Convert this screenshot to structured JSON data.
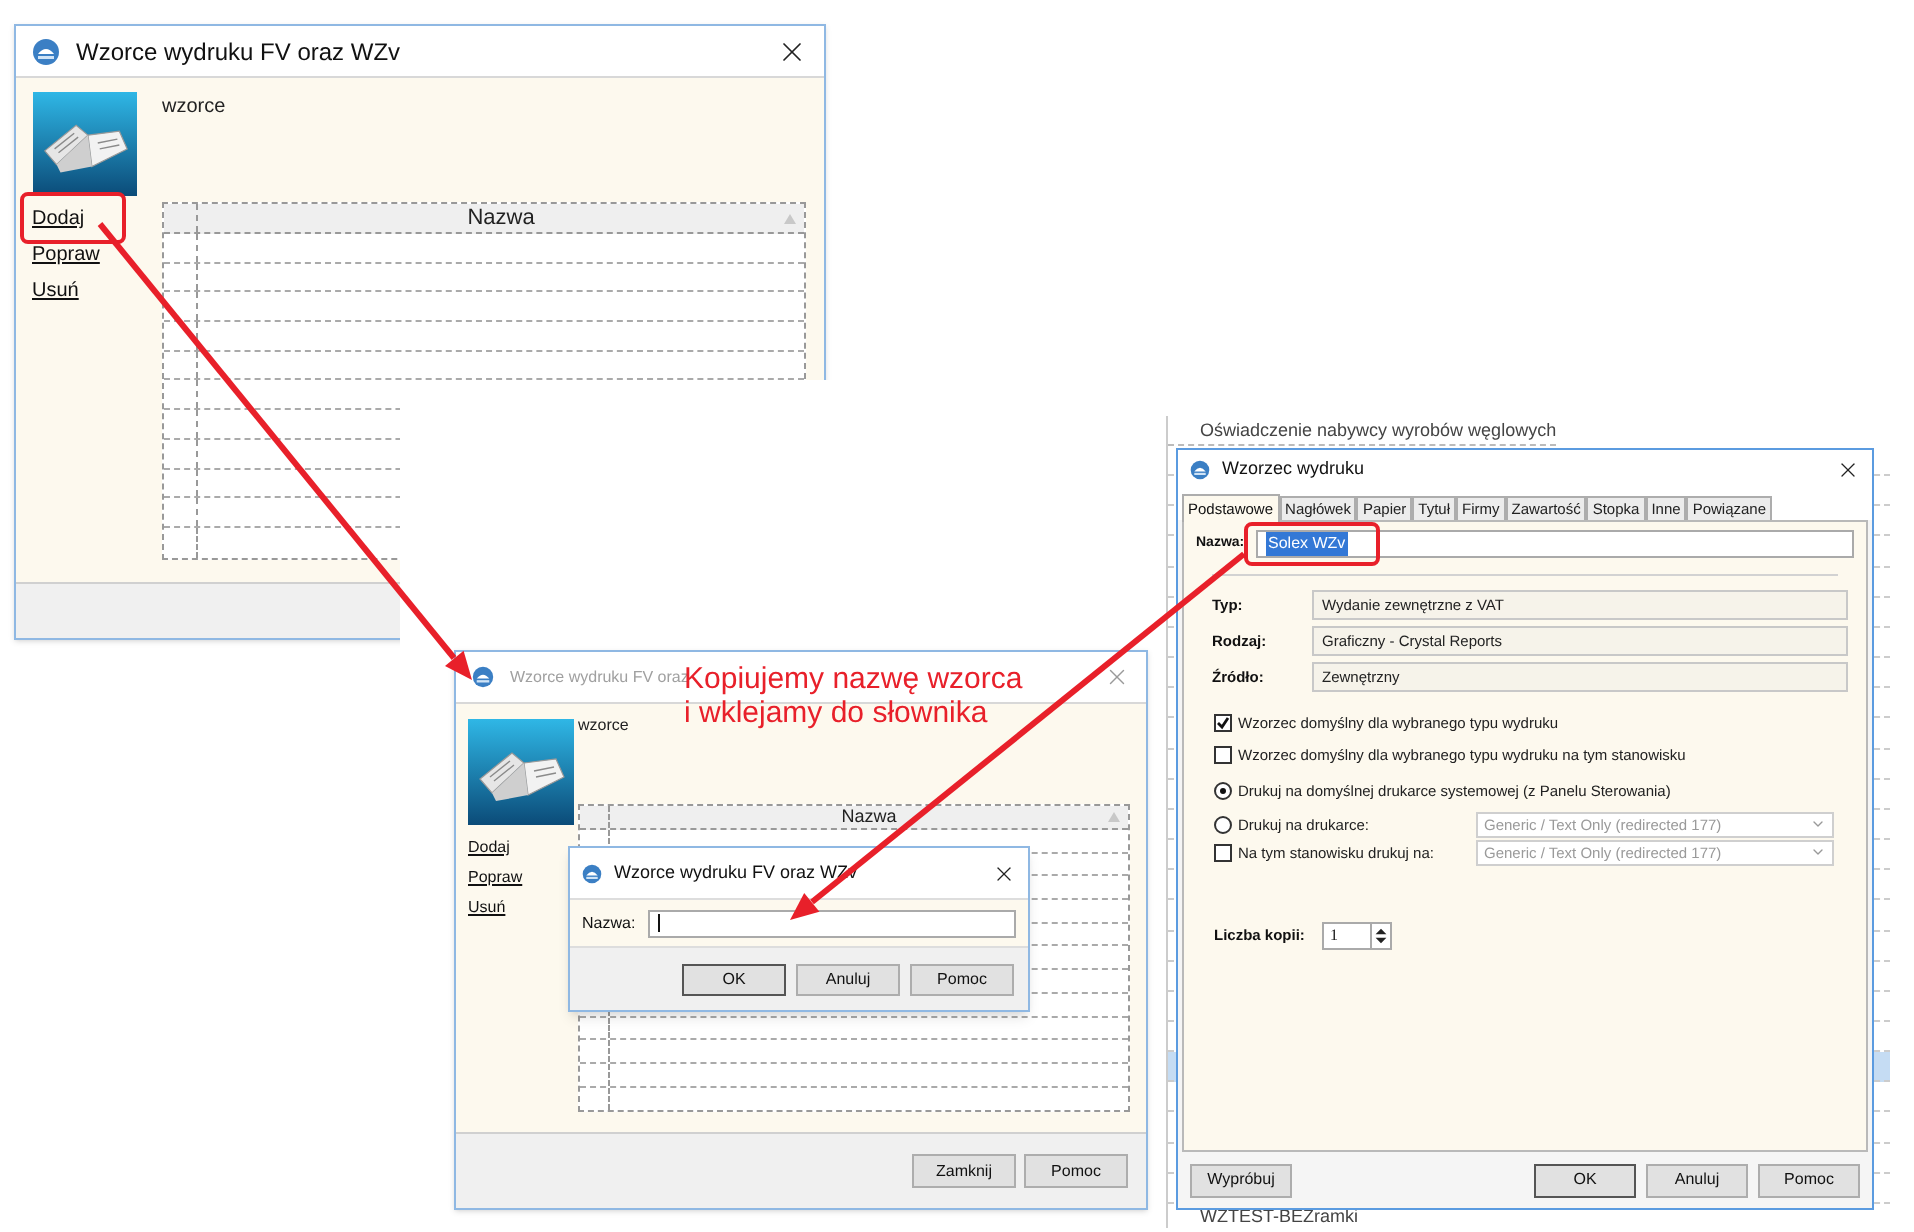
{
  "background_list": {
    "items": [
      "Oświadczenie nabywcy wyrobów węglowych",
      "WZTEST-BEZramki"
    ]
  },
  "windows": [
    {
      "title": "Wzorce wydruku FV oraz WZv",
      "active": true,
      "section": "wzorce",
      "actions": [
        "Dodaj",
        "Popraw",
        "Usuń"
      ],
      "column": "Nazwa"
    },
    {
      "title": "Wzorce wydruku FV oraz",
      "active": false,
      "section": "wzorce",
      "actions": [
        "Dodaj",
        "Popraw",
        "Usuń"
      ],
      "column": "Nazwa",
      "footer_buttons": [
        "Zamknij",
        "Pomoc"
      ]
    }
  ],
  "name_dialog": {
    "title": "Wzorce wydruku FV oraz WZv",
    "label": "Nazwa:",
    "buttons": [
      "OK",
      "Anuluj",
      "Pomoc"
    ]
  },
  "template_editor": {
    "title": "Wzorzec wydruku",
    "tabs": [
      {
        "label": "Podstawowe",
        "selected": true
      },
      {
        "label": "Nagłówek",
        "selected": false
      },
      {
        "label": "Papier",
        "selected": false
      },
      {
        "label": "Tytuł",
        "selected": false
      },
      {
        "label": "Firmy",
        "selected": false
      },
      {
        "label": "Zawartość",
        "selected": false
      },
      {
        "label": "Stopka",
        "selected": false
      },
      {
        "label": "Inne",
        "selected": false
      },
      {
        "label": "Powiązane",
        "selected": false
      }
    ],
    "name_label": "Nazwa:",
    "name_value": "Solex WZv",
    "fields": [
      {
        "label": "Typ:",
        "value": "Wydanie zewnętrzne z VAT"
      },
      {
        "label": "Rodzaj:",
        "value": "Graficzny - Crystal Reports"
      },
      {
        "label": "Źródło:",
        "value": "Zewnętrzny"
      }
    ],
    "options": [
      {
        "kind": "checkbox",
        "label": "Wzorzec domyślny dla wybranego typu wydruku",
        "checked": true
      },
      {
        "kind": "checkbox",
        "label": "Wzorzec domyślny dla wybranego typu wydruku na tym stanowisku",
        "checked": false
      },
      {
        "kind": "radio",
        "label": "Drukuj na domyślnej drukarce systemowej (z Panelu Sterowania)",
        "selected": true
      },
      {
        "kind": "radio",
        "label": "Drukuj na drukarce:",
        "selected": false,
        "select": {
          "value": "Generic / Text Only (redirected 177)",
          "disabled": true
        }
      },
      {
        "kind": "checkbox",
        "label": "Na tym stanowisku drukuj na:",
        "checked": false,
        "select": {
          "value": "Generic / Text Only (redirected 177)",
          "disabled": true
        }
      }
    ],
    "copies_label": "Liczba kopii:",
    "copies_value": "1",
    "left_button": "Wypróbuj",
    "buttons": [
      "OK",
      "Anuluj",
      "Pomoc"
    ]
  },
  "annotation": {
    "lines": [
      "Kopiujemy nazwę wzorca",
      "i wklejamy do słownika"
    ]
  }
}
